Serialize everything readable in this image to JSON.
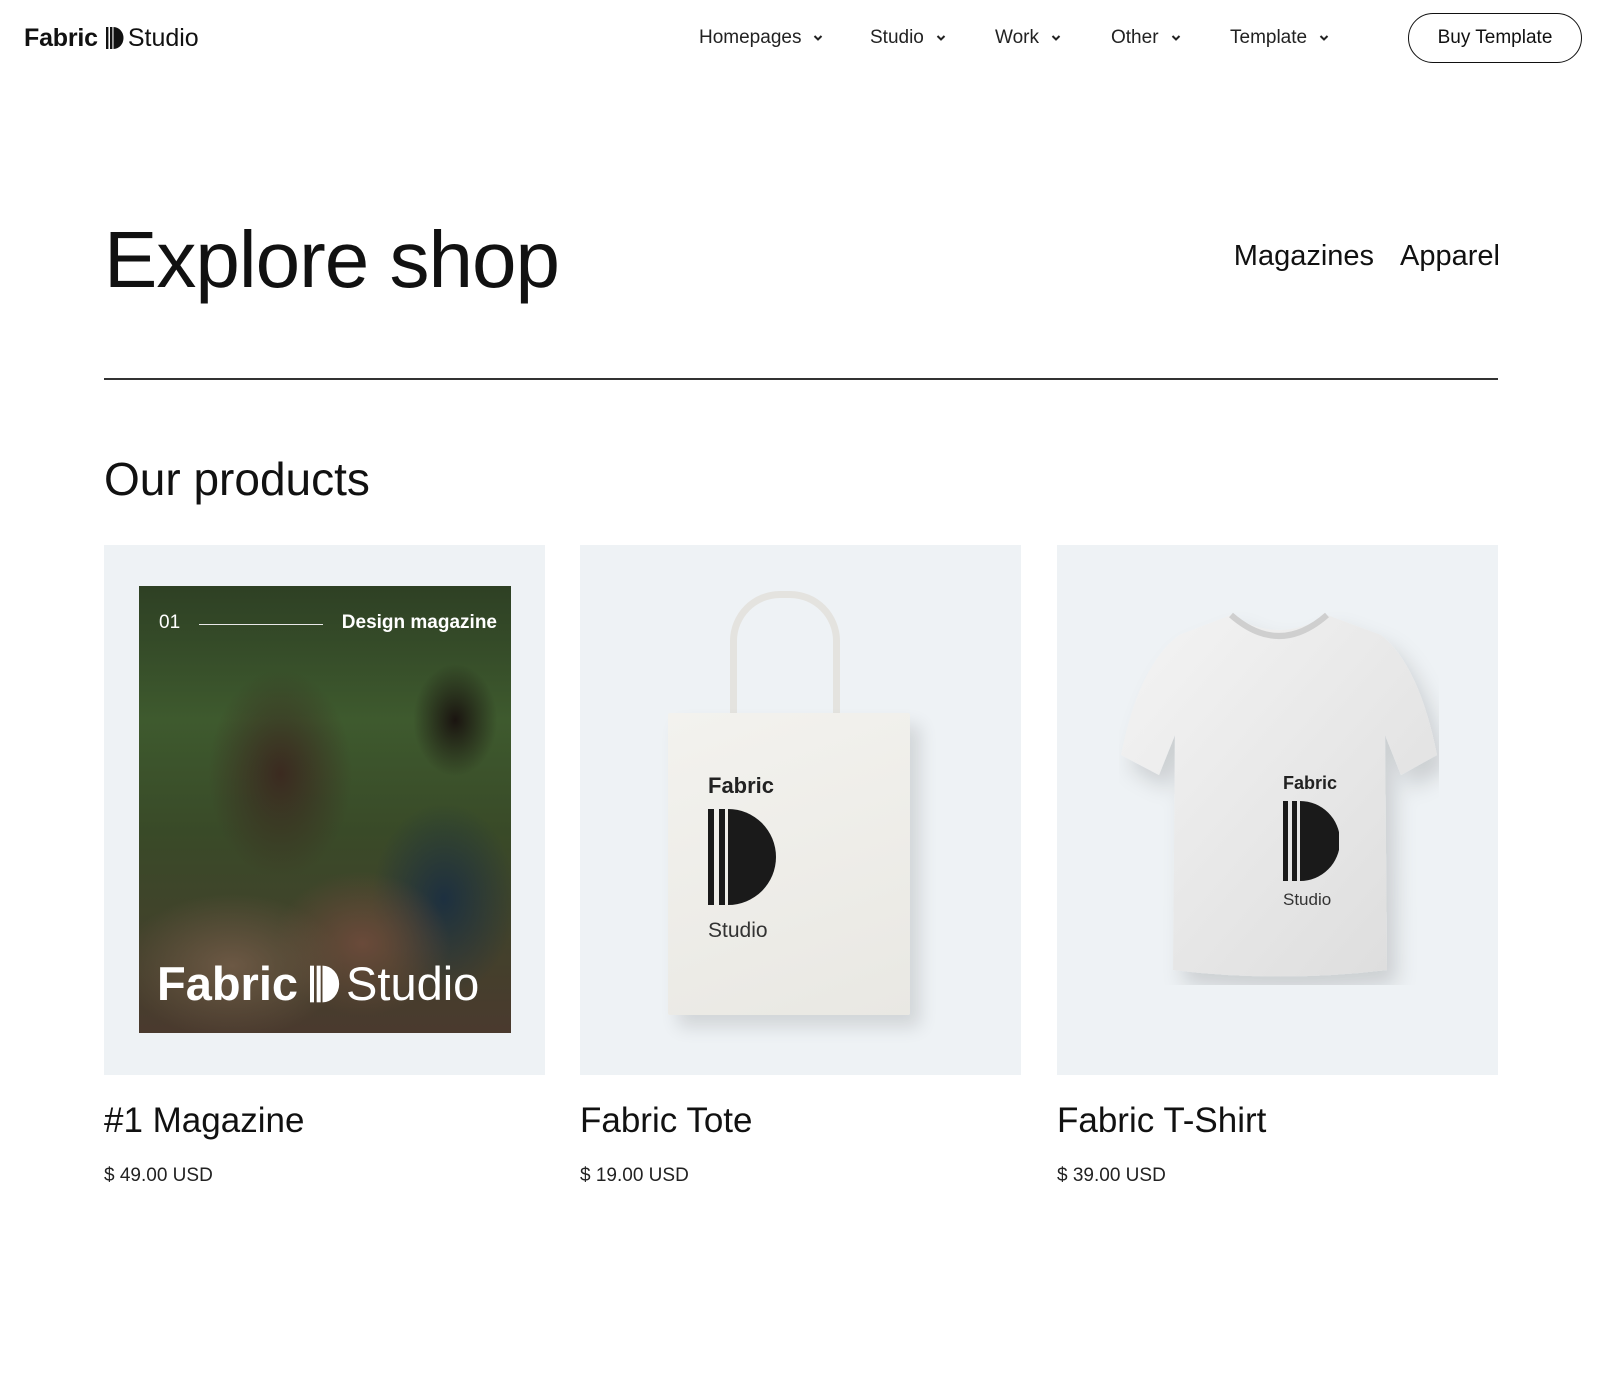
{
  "header": {
    "logo": {
      "word1": "Fabric",
      "word2": "Studio"
    },
    "nav": [
      {
        "label": "Homepages"
      },
      {
        "label": "Studio"
      },
      {
        "label": "Work"
      },
      {
        "label": "Other"
      },
      {
        "label": "Template"
      }
    ],
    "cta_label": "Buy Template"
  },
  "hero": {
    "title": "Explore shop",
    "filters": [
      "Magazines",
      "Apparel"
    ]
  },
  "products_section": {
    "title": "Our products",
    "items": [
      {
        "name": "#1 Magazine",
        "price": "$ 49.00 USD",
        "image": {
          "issue_number": "01",
          "tag": "Design magazine",
          "logo_word1": "Fabric",
          "logo_word2": "Studio"
        }
      },
      {
        "name": "Fabric Tote",
        "price": "$ 19.00 USD",
        "image": {
          "print_word1": "Fabric",
          "print_word2": "Studio"
        }
      },
      {
        "name": "Fabric T-Shirt",
        "price": "$ 39.00 USD",
        "image": {
          "print_word1": "Fabric",
          "print_word2": "Studio"
        }
      }
    ]
  },
  "colors": {
    "text": "#111111",
    "card_background": "#eef2f5",
    "divider": "#333333"
  }
}
